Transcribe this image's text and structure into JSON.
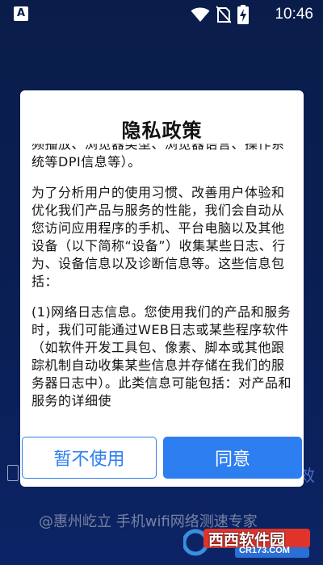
{
  "status_bar": {
    "app_icon_letter": "A",
    "time": "10:46",
    "icons": [
      "wifi-icon",
      "no-sim-icon",
      "battery-charging-icon"
    ]
  },
  "background": {
    "right_fragment": "效",
    "watermark": "@惠州屹立 手机wifi网络测速专家",
    "site_logo_name": "西西软件园",
    "site_logo_url": "CR173.COM"
  },
  "dialog": {
    "title": "隐私政策",
    "paragraphs": [
      "频播放、浏览器类型、浏览器语言、操作系统等DPI信息等）。",
      "为了分析用户的使用习惯、改善用户体验和优化我们产品与服务的性能，我们会自动从您访问应用程序的手机、平台电脑以及其他设备（以下简称“设备”）收集某些日志、行为、设备信息以及诊断信息等。这些信息包括：",
      "(1)网络日志信息。您使用我们的产品和服务时，我们可能通过WEB日志或某些程序软件（如软件开发工具包、像素、脚本或其他跟踪机制自动收集某些信息并存储在我们的服务器日志中）。此类信息可能包括：对产品和服务的详细使"
    ],
    "decline_label": "暂不使用",
    "agree_label": "同意"
  },
  "colors": {
    "accent": "#2d7ef0",
    "background_top": "#0a1d4a",
    "background_bottom": "#0c2466"
  }
}
